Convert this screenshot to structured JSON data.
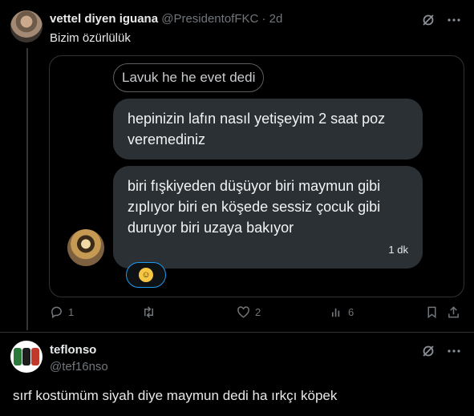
{
  "tweet": {
    "author_name": "vettel diyen iguana",
    "author_handle": "@PresidentofFKC",
    "dot": "·",
    "age": "2d",
    "text": "Bizim özürlülük",
    "media": {
      "quoted_reply": "Lavuk he he evet dedi",
      "message1": "hepinizin lafın nasıl yetişeyim 2 saat poz veremediniz",
      "message2": "biri fışkiyeden düşüyor biri maymun gibi zıplıyor biri en köşede sessiz çocuk gibi duruyor biri uzaya bakıyor",
      "message2_time": "1 dk",
      "reaction_icon": "laughing-emoji-icon"
    },
    "actions": {
      "reply_count": "1",
      "retweet_count": "",
      "like_count": "2",
      "views_count": "6"
    }
  },
  "reply": {
    "author_name": "teflonso",
    "author_handle": "@tef16nso",
    "text": "sırf kostümüm siyah diye maymun dedi ha ırkçı köpek"
  },
  "colors": {
    "background": "#000000",
    "text_primary": "#e7e9ea",
    "text_secondary": "#71767b",
    "bubble": "#2b3034",
    "accent": "#1d9bf0"
  }
}
